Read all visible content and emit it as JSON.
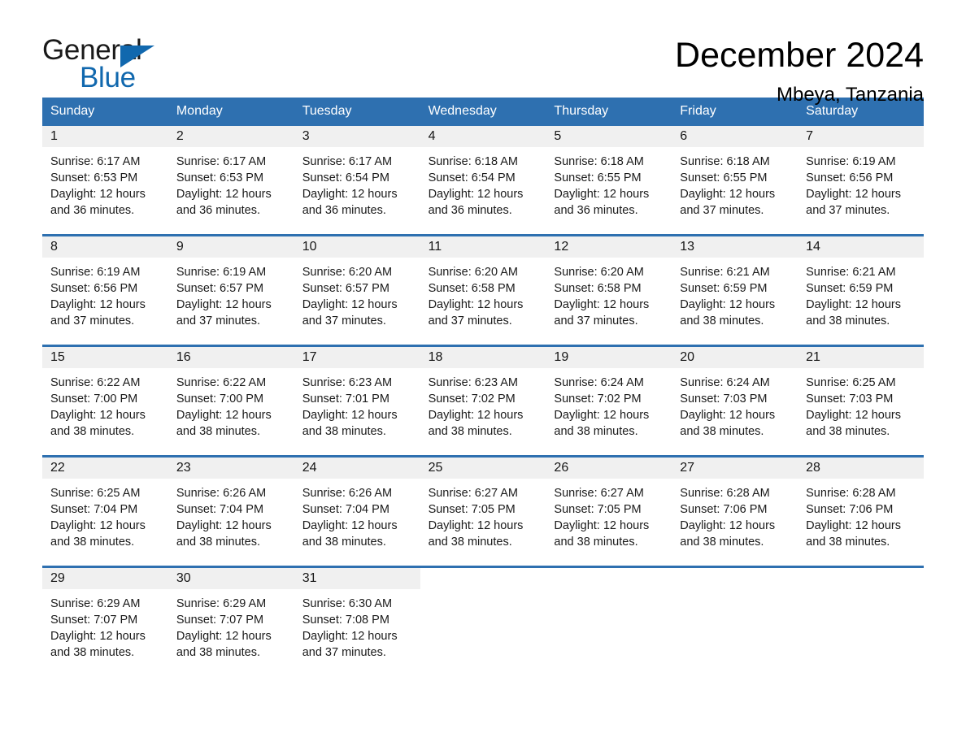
{
  "brand": {
    "name_top": "General",
    "name_bottom": "Blue",
    "triangle_color": "#1168ae",
    "blue_color": "#1168ae"
  },
  "header": {
    "month_title": "December 2024",
    "location": "Mbeya, Tanzania"
  },
  "theme": {
    "header_blue": "#2e70b0",
    "daynum_band": "#f0f0f0",
    "page_background": "#ffffff",
    "text_color": "#1a1a1a"
  },
  "calendar": {
    "weekdays": [
      "Sunday",
      "Monday",
      "Tuesday",
      "Wednesday",
      "Thursday",
      "Friday",
      "Saturday"
    ],
    "weeks": [
      [
        {
          "day": "1",
          "sunrise": "Sunrise: 6:17 AM",
          "sunset": "Sunset: 6:53 PM",
          "daylight": "Daylight: 12 hours and 36 minutes."
        },
        {
          "day": "2",
          "sunrise": "Sunrise: 6:17 AM",
          "sunset": "Sunset: 6:53 PM",
          "daylight": "Daylight: 12 hours and 36 minutes."
        },
        {
          "day": "3",
          "sunrise": "Sunrise: 6:17 AM",
          "sunset": "Sunset: 6:54 PM",
          "daylight": "Daylight: 12 hours and 36 minutes."
        },
        {
          "day": "4",
          "sunrise": "Sunrise: 6:18 AM",
          "sunset": "Sunset: 6:54 PM",
          "daylight": "Daylight: 12 hours and 36 minutes."
        },
        {
          "day": "5",
          "sunrise": "Sunrise: 6:18 AM",
          "sunset": "Sunset: 6:55 PM",
          "daylight": "Daylight: 12 hours and 36 minutes."
        },
        {
          "day": "6",
          "sunrise": "Sunrise: 6:18 AM",
          "sunset": "Sunset: 6:55 PM",
          "daylight": "Daylight: 12 hours and 37 minutes."
        },
        {
          "day": "7",
          "sunrise": "Sunrise: 6:19 AM",
          "sunset": "Sunset: 6:56 PM",
          "daylight": "Daylight: 12 hours and 37 minutes."
        }
      ],
      [
        {
          "day": "8",
          "sunrise": "Sunrise: 6:19 AM",
          "sunset": "Sunset: 6:56 PM",
          "daylight": "Daylight: 12 hours and 37 minutes."
        },
        {
          "day": "9",
          "sunrise": "Sunrise: 6:19 AM",
          "sunset": "Sunset: 6:57 PM",
          "daylight": "Daylight: 12 hours and 37 minutes."
        },
        {
          "day": "10",
          "sunrise": "Sunrise: 6:20 AM",
          "sunset": "Sunset: 6:57 PM",
          "daylight": "Daylight: 12 hours and 37 minutes."
        },
        {
          "day": "11",
          "sunrise": "Sunrise: 6:20 AM",
          "sunset": "Sunset: 6:58 PM",
          "daylight": "Daylight: 12 hours and 37 minutes."
        },
        {
          "day": "12",
          "sunrise": "Sunrise: 6:20 AM",
          "sunset": "Sunset: 6:58 PM",
          "daylight": "Daylight: 12 hours and 37 minutes."
        },
        {
          "day": "13",
          "sunrise": "Sunrise: 6:21 AM",
          "sunset": "Sunset: 6:59 PM",
          "daylight": "Daylight: 12 hours and 38 minutes."
        },
        {
          "day": "14",
          "sunrise": "Sunrise: 6:21 AM",
          "sunset": "Sunset: 6:59 PM",
          "daylight": "Daylight: 12 hours and 38 minutes."
        }
      ],
      [
        {
          "day": "15",
          "sunrise": "Sunrise: 6:22 AM",
          "sunset": "Sunset: 7:00 PM",
          "daylight": "Daylight: 12 hours and 38 minutes."
        },
        {
          "day": "16",
          "sunrise": "Sunrise: 6:22 AM",
          "sunset": "Sunset: 7:00 PM",
          "daylight": "Daylight: 12 hours and 38 minutes."
        },
        {
          "day": "17",
          "sunrise": "Sunrise: 6:23 AM",
          "sunset": "Sunset: 7:01 PM",
          "daylight": "Daylight: 12 hours and 38 minutes."
        },
        {
          "day": "18",
          "sunrise": "Sunrise: 6:23 AM",
          "sunset": "Sunset: 7:02 PM",
          "daylight": "Daylight: 12 hours and 38 minutes."
        },
        {
          "day": "19",
          "sunrise": "Sunrise: 6:24 AM",
          "sunset": "Sunset: 7:02 PM",
          "daylight": "Daylight: 12 hours and 38 minutes."
        },
        {
          "day": "20",
          "sunrise": "Sunrise: 6:24 AM",
          "sunset": "Sunset: 7:03 PM",
          "daylight": "Daylight: 12 hours and 38 minutes."
        },
        {
          "day": "21",
          "sunrise": "Sunrise: 6:25 AM",
          "sunset": "Sunset: 7:03 PM",
          "daylight": "Daylight: 12 hours and 38 minutes."
        }
      ],
      [
        {
          "day": "22",
          "sunrise": "Sunrise: 6:25 AM",
          "sunset": "Sunset: 7:04 PM",
          "daylight": "Daylight: 12 hours and 38 minutes."
        },
        {
          "day": "23",
          "sunrise": "Sunrise: 6:26 AM",
          "sunset": "Sunset: 7:04 PM",
          "daylight": "Daylight: 12 hours and 38 minutes."
        },
        {
          "day": "24",
          "sunrise": "Sunrise: 6:26 AM",
          "sunset": "Sunset: 7:04 PM",
          "daylight": "Daylight: 12 hours and 38 minutes."
        },
        {
          "day": "25",
          "sunrise": "Sunrise: 6:27 AM",
          "sunset": "Sunset: 7:05 PM",
          "daylight": "Daylight: 12 hours and 38 minutes."
        },
        {
          "day": "26",
          "sunrise": "Sunrise: 6:27 AM",
          "sunset": "Sunset: 7:05 PM",
          "daylight": "Daylight: 12 hours and 38 minutes."
        },
        {
          "day": "27",
          "sunrise": "Sunrise: 6:28 AM",
          "sunset": "Sunset: 7:06 PM",
          "daylight": "Daylight: 12 hours and 38 minutes."
        },
        {
          "day": "28",
          "sunrise": "Sunrise: 6:28 AM",
          "sunset": "Sunset: 7:06 PM",
          "daylight": "Daylight: 12 hours and 38 minutes."
        }
      ],
      [
        {
          "day": "29",
          "sunrise": "Sunrise: 6:29 AM",
          "sunset": "Sunset: 7:07 PM",
          "daylight": "Daylight: 12 hours and 38 minutes."
        },
        {
          "day": "30",
          "sunrise": "Sunrise: 6:29 AM",
          "sunset": "Sunset: 7:07 PM",
          "daylight": "Daylight: 12 hours and 38 minutes."
        },
        {
          "day": "31",
          "sunrise": "Sunrise: 6:30 AM",
          "sunset": "Sunset: 7:08 PM",
          "daylight": "Daylight: 12 hours and 37 minutes."
        },
        {
          "day": "",
          "sunrise": "",
          "sunset": "",
          "daylight": ""
        },
        {
          "day": "",
          "sunrise": "",
          "sunset": "",
          "daylight": ""
        },
        {
          "day": "",
          "sunrise": "",
          "sunset": "",
          "daylight": ""
        },
        {
          "day": "",
          "sunrise": "",
          "sunset": "",
          "daylight": ""
        }
      ]
    ]
  }
}
